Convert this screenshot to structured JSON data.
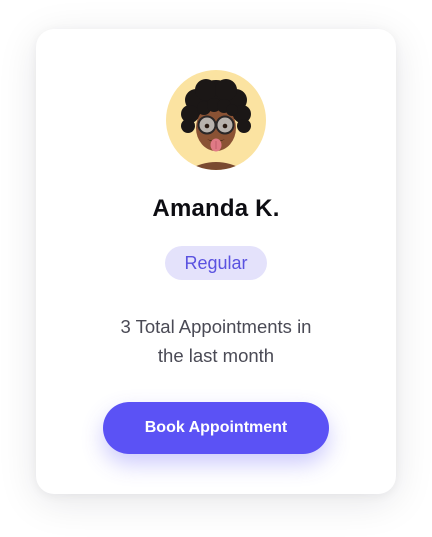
{
  "profile": {
    "name": "Amanda K.",
    "avatar_icon": "memoji-avatar",
    "avatar_bg": "#fbe3a1"
  },
  "badge": {
    "label": "Regular",
    "bg": "#e4e2fb",
    "color": "#5a52e0"
  },
  "summary": {
    "line1": "3 Total Appointments in",
    "line2": "the last month"
  },
  "actions": {
    "book_label": "Book Appointment",
    "accent": "#5b52f5"
  }
}
